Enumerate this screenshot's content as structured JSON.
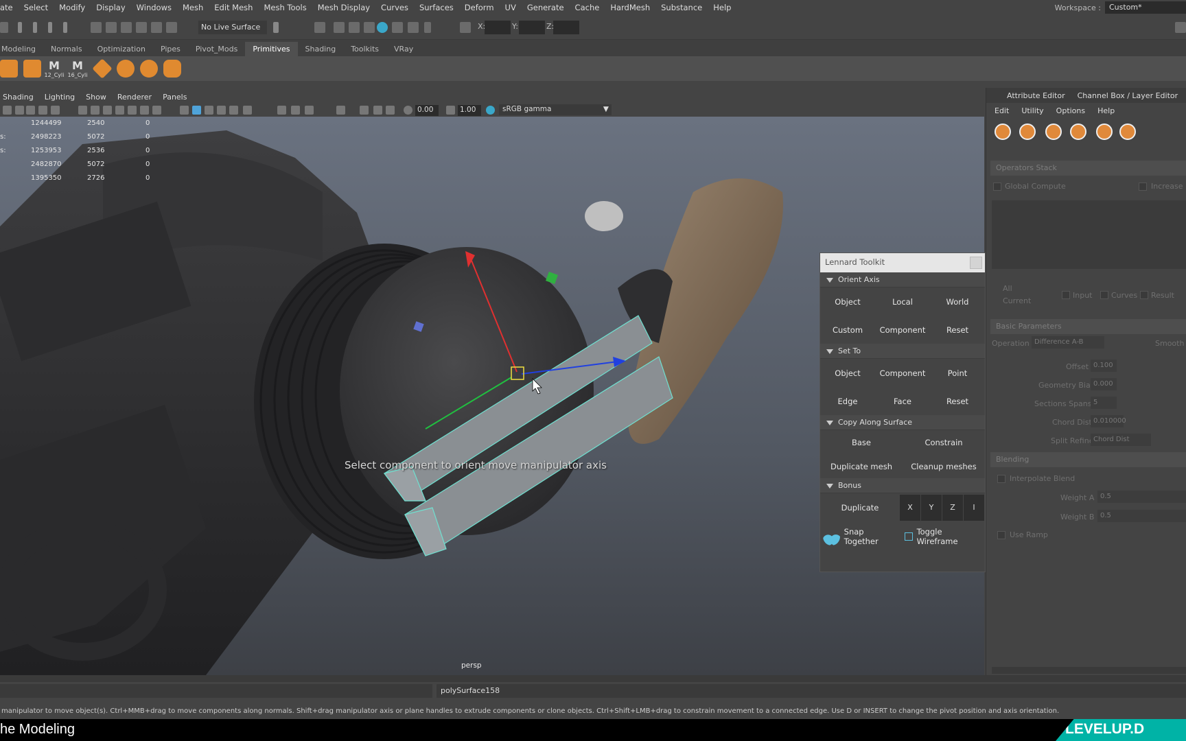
{
  "menubar": {
    "items": [
      "ate",
      "Select",
      "Modify",
      "Display",
      "Windows",
      "Mesh",
      "Edit Mesh",
      "Mesh Tools",
      "Mesh Display",
      "Curves",
      "Surfaces",
      "Deform",
      "UV",
      "Generate",
      "Cache",
      "HardMesh",
      "Substance",
      "Help"
    ],
    "workspace_label": "Workspace :",
    "workspace_value": "Custom*"
  },
  "statusline": {
    "live_surface": "No Live Surface",
    "x_label": "X:",
    "y_label": "Y:",
    "z_label": "Z:"
  },
  "shelf": {
    "tabs": [
      "Modeling",
      "Normals",
      "Optimization",
      "Pipes",
      "Pivot_Mods",
      "Primitives",
      "Shading",
      "Toolkits",
      "VRay"
    ],
    "active_tab": "Primitives",
    "icon_labels": [
      "12_Cyli",
      "16_Cyli"
    ],
    "m_glyph": "M"
  },
  "panel_menu": {
    "items": [
      "Shading",
      "Lighting",
      "Show",
      "Renderer",
      "Panels"
    ],
    "exposure": "0.00",
    "gamma": "1.00",
    "color_space": "sRGB gamma"
  },
  "viewport": {
    "hud_rows": [
      {
        "label": "",
        "a": "1244499",
        "b": "2540",
        "c": "0"
      },
      {
        "label": "s:",
        "a": "2498223",
        "b": "5072",
        "c": "0"
      },
      {
        "label": "s:",
        "a": "1253953",
        "b": "2536",
        "c": "0"
      },
      {
        "label": "",
        "a": "2482870",
        "b": "5072",
        "c": "0"
      },
      {
        "label": "",
        "a": "1395350",
        "b": "2726",
        "c": "0"
      }
    ],
    "hint": "Select component to orient move manipulator axis",
    "camera": "persp"
  },
  "toolkit": {
    "title": "Lennard Toolkit",
    "orient_axis": {
      "title": "Orient Axis",
      "row1": [
        "Object",
        "Local",
        "World"
      ],
      "row2": [
        "Custom",
        "Component",
        "Reset"
      ]
    },
    "set_to": {
      "title": "Set To",
      "row1": [
        "Object",
        "Component",
        "Point"
      ],
      "row2": [
        "Edge",
        "Face",
        "Reset"
      ]
    },
    "copy_along": {
      "title": "Copy Along Surface",
      "row1": [
        "Base",
        "Constrain"
      ],
      "row2": [
        "Duplicate mesh",
        "Cleanup meshes"
      ]
    },
    "bonus": {
      "title": "Bonus",
      "duplicate": "Duplicate",
      "axes": [
        "X",
        "Y",
        "Z",
        "I"
      ]
    },
    "snap_together": "Snap Together",
    "toggle_wireframe": "Toggle Wireframe"
  },
  "right_panel": {
    "tabs": [
      "Attribute Editor",
      "Channel Box / Layer Editor"
    ],
    "menu": [
      "Edit",
      "Utility",
      "Options",
      "Help"
    ],
    "operators_stack": "Operators Stack",
    "global_compute": "Global Compute",
    "increase": "Increase",
    "all": "All",
    "current": "Current",
    "input": "Input",
    "curves": "Curves",
    "result": "Result",
    "basic_parameters": "Basic Parameters",
    "operation_label": "Operation",
    "operation_value": "Difference A-B",
    "smooth": "Smooth",
    "offset_label": "Offset",
    "offset_value": "0.100",
    "geometry_bias_label": "Geometry Bias",
    "geometry_bias_value": "0.000",
    "sections_spans_label": "Sections Spans",
    "sections_spans_value": "5",
    "chord_dist_label": "Chord Dist",
    "chord_dist_value": "0.010000",
    "split_refine_label": "Split Refine",
    "split_refine_value": "Chord Dist",
    "blending": "Blending",
    "interpolate_blend": "Interpolate Blend",
    "weight_a_label": "Weight A",
    "weight_a_value": "0.5",
    "weight_b_label": "Weight B",
    "weight_b_value": "0.5",
    "use_ramp": "Use Ramp"
  },
  "cmdline": {
    "object": "polySurface158"
  },
  "helpline": "manipulator to move object(s). Ctrl+MMB+drag to move components along normals. Shift+drag manipulator axis or plane handles to extrude components or clone objects. Ctrl+Shift+LMB+drag to constrain movement to a connected edge. Use D or INSERT to change the pivot position and axis orientation.",
  "footer": {
    "title": "he Modeling",
    "brand": "LEVELUP.D"
  }
}
